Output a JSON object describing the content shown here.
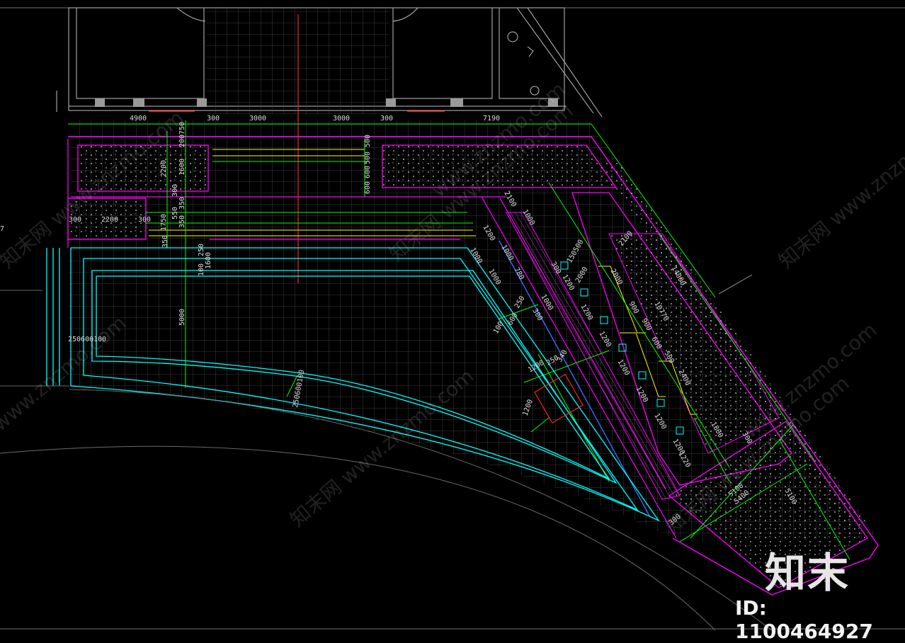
{
  "colors": {
    "background": "#000000",
    "magenta": "#ff00ff",
    "cyan": "#00ffff",
    "green": "#00ff00",
    "yellow": "#ffff00",
    "red": "#ff2020",
    "grid": "#5a5a5a",
    "white": "#e6e6e6"
  },
  "dims": {
    "top_4900": "4900",
    "top_300a": "300",
    "top_3000a": "3000",
    "top_3000b": "3000",
    "top_300b": "300",
    "top_7190": "7190",
    "v_750": "750",
    "v_200": "200",
    "v_2200": "2200",
    "v_1600": "1600",
    "v_300": "300",
    "v_350a": "350",
    "v_550": "550",
    "v_1750": "1750",
    "v_350b": "350",
    "v_350c": "350",
    "v_250": "250",
    "v_100": "100",
    "v_1600b": "1600",
    "v_5000": "5000",
    "h_300": "300",
    "h_2200": "2200",
    "h_300b": "300",
    "mid_500": "500",
    "mid_500b": "500",
    "mid_600": "600",
    "mid_600b": "600",
    "d_2100a": "2100",
    "d_1000a": "1000",
    "d_1200": "1200",
    "d_1000b": "1000",
    "d_1000c": "1000",
    "d_780": "780",
    "d_1000d": "1000",
    "d_1000e": "1000",
    "d_250a": "250",
    "d_300a": "300",
    "d_600a": "600",
    "d_100a": "100",
    "d_150500": "150500",
    "d_2000": "2000",
    "d_300b": "300",
    "d_1200a": "1200",
    "d_1200b": "1200",
    "d_2100b": "2100",
    "d_14000": "14000",
    "d_10770": "10770",
    "d_2000b": "2000",
    "d_900": "900",
    "d_900b": "900",
    "d_600b": "600",
    "d_500": "500",
    "d_2400": "2400",
    "d_1200c": "1200",
    "d_1200d": "1200",
    "d_1200e": "1200",
    "d_1200f": "1200",
    "d_1200g": "1200",
    "d_250b": "250",
    "d_340": "340",
    "d_1200h": "1200",
    "d_1200i": "1200",
    "d_1800": "1800",
    "d_300c": "300",
    "d_1220": "1220",
    "d_5100": "5100",
    "d_5400": "5400",
    "d_5100b": "5100",
    "d_3580": "3580",
    "d_300d": "300",
    "l_250600100": "250600100",
    "c_250600100": "250600100",
    "edge_7": "7"
  },
  "watermarks": {
    "w1": "知末网 www.znzmo.com",
    "w2": "知末网 www.znzmo.com",
    "w3": "知末网 www.znzmo.com",
    "w4": "知末网 www.znzmo.com",
    "w5": "知末网 www.znzmo.com",
    "w6": "www.znzmo.com",
    "w7": "www.znzmo.com",
    "w8": "www.znzmo.com"
  },
  "logo": "知末",
  "id_label": "ID: 1100464927"
}
